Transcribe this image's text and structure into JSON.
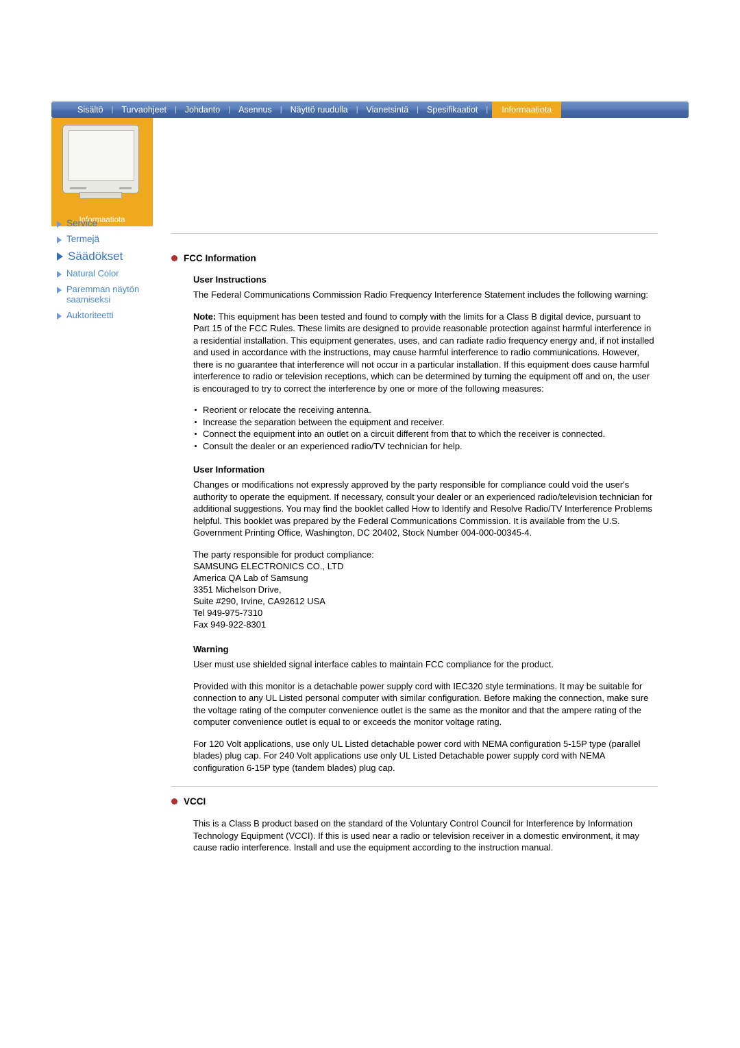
{
  "nav": {
    "items": [
      {
        "label": "Sisältö",
        "active": false
      },
      {
        "label": "Turvaohjeet",
        "active": false
      },
      {
        "label": "Johdanto",
        "active": false
      },
      {
        "label": "Asennus",
        "active": false
      },
      {
        "label": "Näyttö ruudulla",
        "active": false
      },
      {
        "label": "Vianetsintä",
        "active": false
      },
      {
        "label": "Spesifikaatiot",
        "active": false
      },
      {
        "label": "Informaatiota",
        "active": true
      }
    ],
    "separator": "|"
  },
  "panel": {
    "caption": "Informaatiota"
  },
  "sidebar": {
    "items": [
      {
        "label": "Service",
        "current": false,
        "sub": false
      },
      {
        "label": "Termejä",
        "current": false,
        "sub": false
      },
      {
        "label": "Säädökset",
        "current": true,
        "sub": false
      },
      {
        "label": "Natural Color",
        "current": false,
        "sub": true
      },
      {
        "label": "Paremman näytön saamiseksi",
        "current": false,
        "sub": true
      },
      {
        "label": "Auktoriteetti",
        "current": false,
        "sub": true
      }
    ]
  },
  "content": {
    "fcc_heading": "FCC Information",
    "user_instructions_heading": "User Instructions",
    "user_instructions_para": "The Federal Communications Commission Radio Frequency Interference Statement includes the following warning:",
    "note_label": "Note:",
    "note_para": " This equipment has been tested and found to comply with the limits for a Class B digital device, pursuant to Part 15 of the FCC Rules. These limits are designed to provide reasonable protection against harmful interference in a residential installation. This equipment generates, uses, and can radiate radio frequency energy and, if not installed and used in accordance with the instructions, may cause harmful interference to radio communications. However, there is no guarantee that interference will not occur in a particular installation. If this equipment does cause harmful interference to radio or television receptions, which can be determined by turning the equipment off and on, the user is encouraged to try to correct the interference by one or more of the following measures:",
    "measures": [
      "Reorient or relocate the receiving antenna.",
      "Increase the separation between the equipment and receiver.",
      "Connect the equipment into an outlet on a circuit different from that to which the receiver is connected.",
      "Consult the dealer or an experienced radio/TV technician for help."
    ],
    "user_information_heading": "User Information",
    "user_information_para": "Changes or modifications not expressly approved by the party responsible for compliance could void the user's authority to operate the equipment. If necessary, consult your dealer or an experienced radio/television technician for additional suggestions. You may find the booklet called How to Identify and Resolve Radio/TV Interference Problems helpful. This booklet was prepared by the Federal Communications Commission. It is available from the U.S. Government Printing Office, Washington, DC 20402, Stock Number 004-000-00345-4.",
    "responsible_line": "The party responsible for product compliance:",
    "address_lines": [
      "SAMSUNG ELECTRONICS CO., LTD",
      "America QA Lab of Samsung",
      "3351 Michelson Drive,",
      "Suite #290, Irvine, CA92612 USA",
      "Tel 949-975-7310",
      "Fax 949-922-8301"
    ],
    "warning_heading": "Warning",
    "warning_para": "User must use shielded signal interface cables to maintain FCC compliance for the product.",
    "power_cord_para": "Provided with this monitor is a detachable power supply cord with IEC320 style terminations. It may be suitable for connection to any UL Listed personal computer with similar configuration. Before making the connection, make sure the voltage rating of the computer convenience outlet is the same as the monitor and that the ampere rating of the computer convenience outlet is equal to or exceeds the monitor voltage rating.",
    "volt_para": "For 120 Volt applications, use only UL Listed detachable power cord with NEMA configuration 5-15P type (parallel blades) plug cap. For 240 Volt applications use only UL Listed Detachable power supply cord with NEMA configuration 6-15P type (tandem blades) plug cap.",
    "vcci_heading": "VCCI",
    "vcci_para": "This is a Class B product based on the standard of the Voluntary Control Council for Interference by Information Technology Equipment (VCCI). If this is used near a radio or television receiver in a domestic environment, it may cause radio interference. Install and use the equipment according to the instruction manual."
  }
}
